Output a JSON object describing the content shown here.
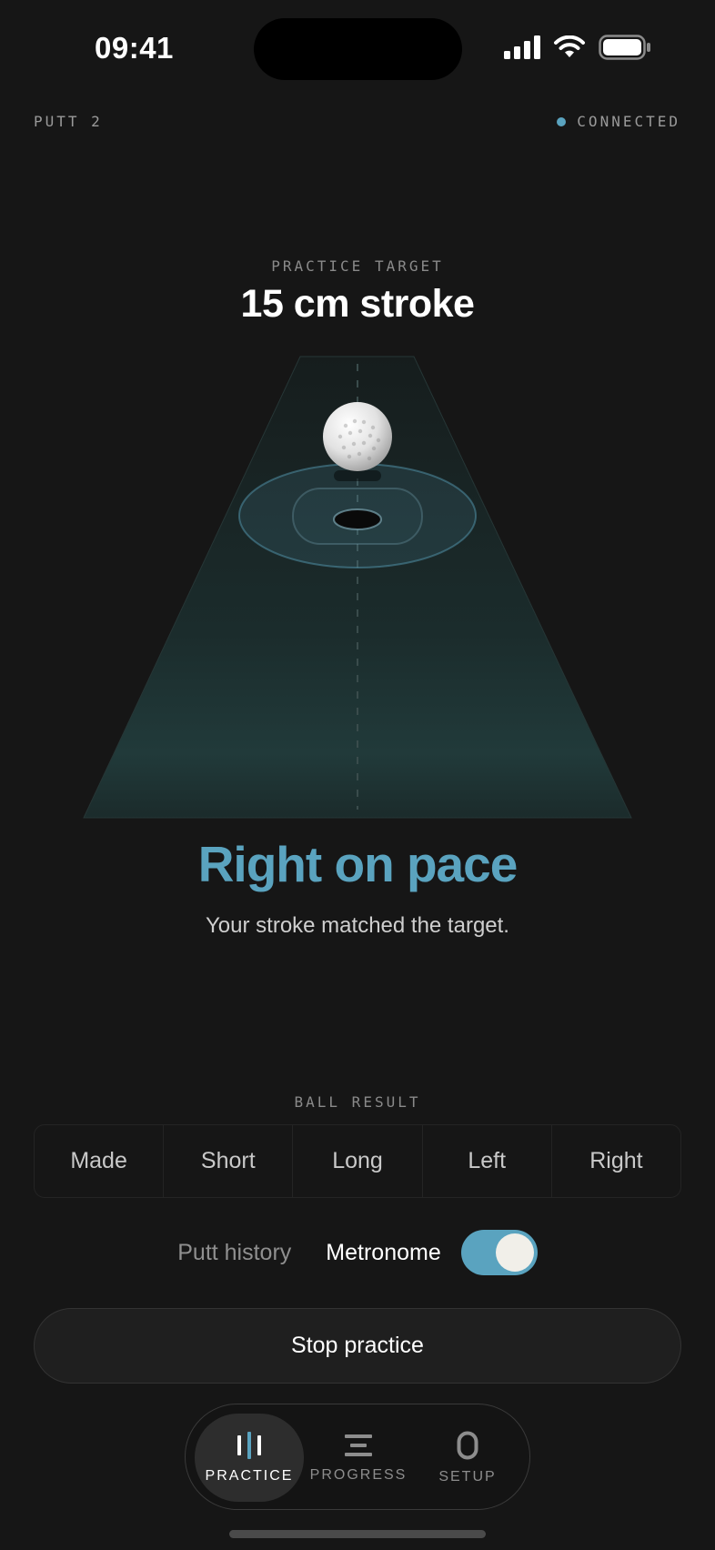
{
  "status_bar": {
    "time": "09:41"
  },
  "header": {
    "putt_label": "PUTT 2",
    "connection_status": "CONNECTED"
  },
  "target": {
    "caption": "PRACTICE TARGET",
    "value": "15 cm stroke"
  },
  "result": {
    "title": "Right on pace",
    "subtitle": "Your stroke matched the target."
  },
  "ball_result": {
    "caption": "BALL RESULT",
    "options": [
      "Made",
      "Short",
      "Long",
      "Left",
      "Right"
    ]
  },
  "controls": {
    "putt_history_label": "Putt history",
    "metronome_label": "Metronome",
    "metronome_on": true
  },
  "stop_button_label": "Stop practice",
  "tabs": [
    {
      "label": "PRACTICE",
      "icon": "practice-bars-icon",
      "active": true
    },
    {
      "label": "PROGRESS",
      "icon": "progress-lines-icon",
      "active": false
    },
    {
      "label": "SETUP",
      "icon": "setup-zero-icon",
      "active": false
    }
  ],
  "colors": {
    "accent": "#5aa3bf",
    "background": "#161616",
    "green_surface": "#1f3535"
  }
}
